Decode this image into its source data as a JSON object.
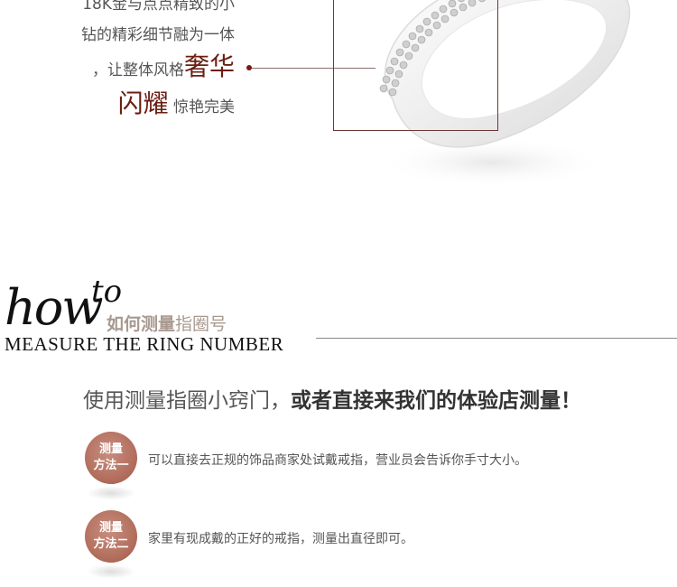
{
  "description": {
    "line1": "18K金与点点精致的小",
    "line2": "钻的精彩细节融为一体",
    "line3_prefix": "，让整体风格",
    "line3_emphasis": "奢华",
    "line4_emphasis": "闪耀",
    "line4_suffix": "惊艳完美"
  },
  "howto": {
    "script_how": "how",
    "script_to": "to",
    "cn_title_bold": "如何测量",
    "cn_title_light": "指圈号",
    "en_subtitle": "MEASURE THE RING NUMBER"
  },
  "intro": {
    "prefix": "使用测量指圈小窍门，",
    "emphasis": "或者直接来我们的体验店测量！"
  },
  "methods": [
    {
      "badge_line1": "测量",
      "badge_line2": "方法一",
      "text": "可以直接去正规的饰品商家处试戴戒指，营业员会告诉你手寸大小。"
    },
    {
      "badge_line1": "测量",
      "badge_line2": "方法二",
      "text": "家里有现成戴的正好的戒指，测量出直径即可。"
    }
  ],
  "colors": {
    "accent": "#6b1e12",
    "badge": "#b4705f",
    "title_gray": "#a8998f"
  }
}
